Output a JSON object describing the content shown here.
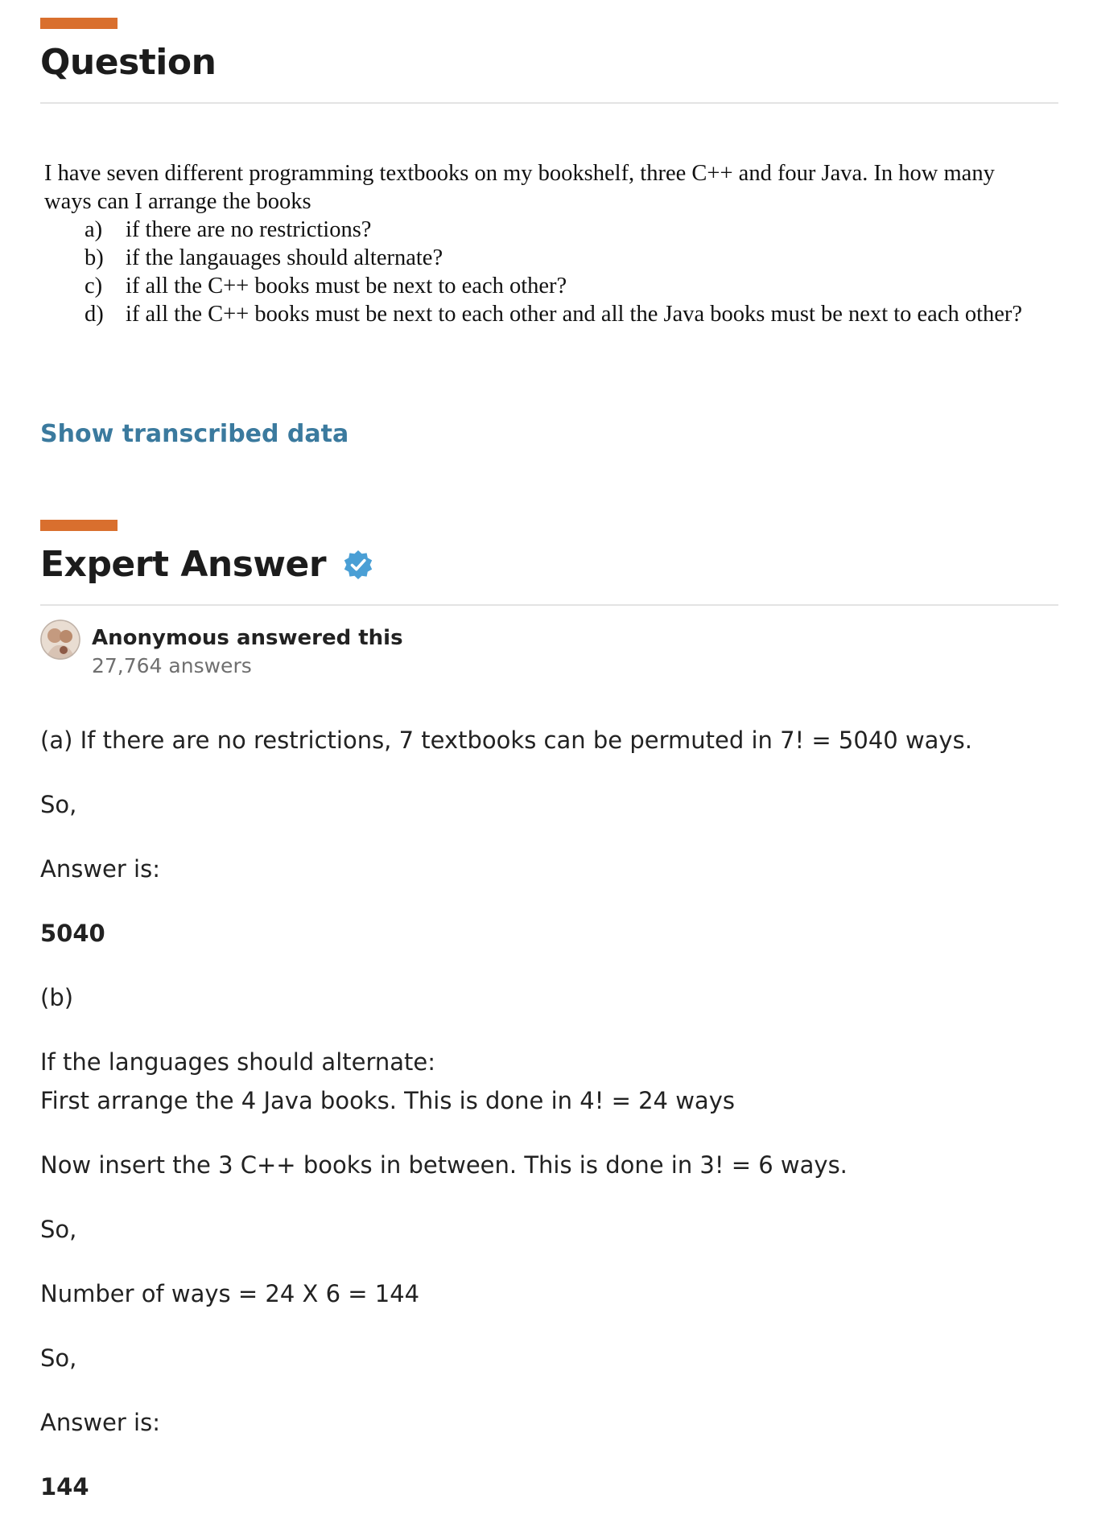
{
  "question_section": {
    "title": "Question",
    "intro": "I have seven different programming textbooks on my bookshelf, three C++ and four Java. In how many ways can I arrange the books",
    "items": [
      {
        "marker": "a)",
        "text": "if there are no restrictions?"
      },
      {
        "marker": "b)",
        "text": "if the langauages should alternate?"
      },
      {
        "marker": "c)",
        "text": "if all the C++ books must be next to each other?"
      },
      {
        "marker": "d)",
        "text": "if all the C++ books must be next to each other and all the Java books must be next to each other?"
      }
    ],
    "show_transcribed_label": "Show transcribed data"
  },
  "answer_section": {
    "title": "Expert Answer",
    "verified_icon": "verified-badge-icon",
    "author": {
      "name": "Anonymous answered this",
      "count": "27,764 answers"
    },
    "lines": [
      "(a) If there are no restrictions, 7 textbooks can be permuted in 7! = 5040 ways.",
      "So,",
      "Answer is:",
      "5040",
      "(b)",
      "If the languages should alternate:",
      "First arrange the 4 Java books. This is done in 4! = 24 ways",
      "Now insert the 3 C++ books in between. This is done in 3! = 6 ways.",
      "So,",
      "Number of ways = 24 X 6 = 144",
      "So,",
      "Answer is:",
      "144"
    ]
  },
  "colors": {
    "accent": "#d96f2e",
    "link": "#3b7a9e",
    "verified": "#4a9fd5",
    "divider": "#e3e3e3"
  }
}
